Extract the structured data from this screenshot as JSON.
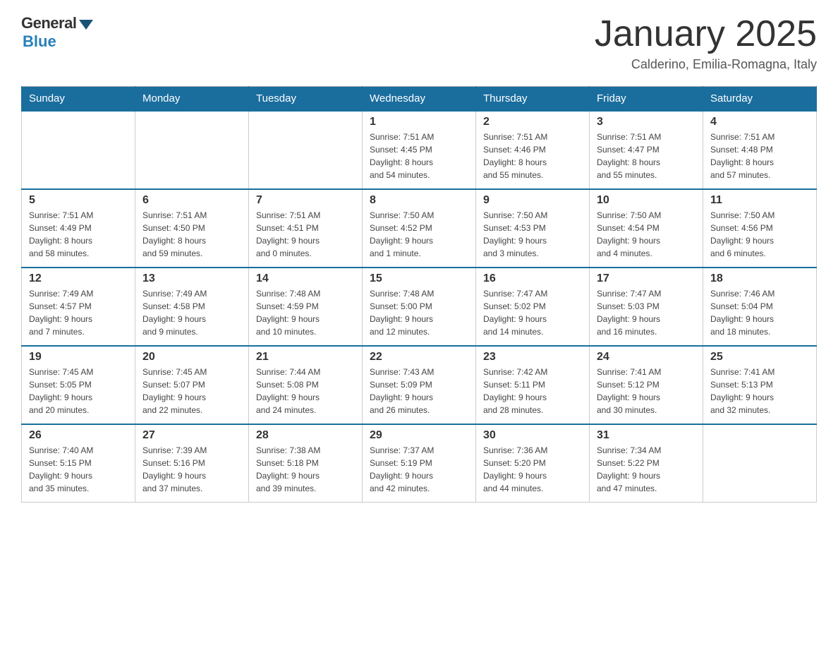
{
  "header": {
    "logo_general": "General",
    "logo_blue": "Blue",
    "month_title": "January 2025",
    "location": "Calderino, Emilia-Romagna, Italy"
  },
  "days_of_week": [
    "Sunday",
    "Monday",
    "Tuesday",
    "Wednesday",
    "Thursday",
    "Friday",
    "Saturday"
  ],
  "weeks": [
    [
      {
        "day": "",
        "info": ""
      },
      {
        "day": "",
        "info": ""
      },
      {
        "day": "",
        "info": ""
      },
      {
        "day": "1",
        "info": "Sunrise: 7:51 AM\nSunset: 4:45 PM\nDaylight: 8 hours\nand 54 minutes."
      },
      {
        "day": "2",
        "info": "Sunrise: 7:51 AM\nSunset: 4:46 PM\nDaylight: 8 hours\nand 55 minutes."
      },
      {
        "day": "3",
        "info": "Sunrise: 7:51 AM\nSunset: 4:47 PM\nDaylight: 8 hours\nand 55 minutes."
      },
      {
        "day": "4",
        "info": "Sunrise: 7:51 AM\nSunset: 4:48 PM\nDaylight: 8 hours\nand 57 minutes."
      }
    ],
    [
      {
        "day": "5",
        "info": "Sunrise: 7:51 AM\nSunset: 4:49 PM\nDaylight: 8 hours\nand 58 minutes."
      },
      {
        "day": "6",
        "info": "Sunrise: 7:51 AM\nSunset: 4:50 PM\nDaylight: 8 hours\nand 59 minutes."
      },
      {
        "day": "7",
        "info": "Sunrise: 7:51 AM\nSunset: 4:51 PM\nDaylight: 9 hours\nand 0 minutes."
      },
      {
        "day": "8",
        "info": "Sunrise: 7:50 AM\nSunset: 4:52 PM\nDaylight: 9 hours\nand 1 minute."
      },
      {
        "day": "9",
        "info": "Sunrise: 7:50 AM\nSunset: 4:53 PM\nDaylight: 9 hours\nand 3 minutes."
      },
      {
        "day": "10",
        "info": "Sunrise: 7:50 AM\nSunset: 4:54 PM\nDaylight: 9 hours\nand 4 minutes."
      },
      {
        "day": "11",
        "info": "Sunrise: 7:50 AM\nSunset: 4:56 PM\nDaylight: 9 hours\nand 6 minutes."
      }
    ],
    [
      {
        "day": "12",
        "info": "Sunrise: 7:49 AM\nSunset: 4:57 PM\nDaylight: 9 hours\nand 7 minutes."
      },
      {
        "day": "13",
        "info": "Sunrise: 7:49 AM\nSunset: 4:58 PM\nDaylight: 9 hours\nand 9 minutes."
      },
      {
        "day": "14",
        "info": "Sunrise: 7:48 AM\nSunset: 4:59 PM\nDaylight: 9 hours\nand 10 minutes."
      },
      {
        "day": "15",
        "info": "Sunrise: 7:48 AM\nSunset: 5:00 PM\nDaylight: 9 hours\nand 12 minutes."
      },
      {
        "day": "16",
        "info": "Sunrise: 7:47 AM\nSunset: 5:02 PM\nDaylight: 9 hours\nand 14 minutes."
      },
      {
        "day": "17",
        "info": "Sunrise: 7:47 AM\nSunset: 5:03 PM\nDaylight: 9 hours\nand 16 minutes."
      },
      {
        "day": "18",
        "info": "Sunrise: 7:46 AM\nSunset: 5:04 PM\nDaylight: 9 hours\nand 18 minutes."
      }
    ],
    [
      {
        "day": "19",
        "info": "Sunrise: 7:45 AM\nSunset: 5:05 PM\nDaylight: 9 hours\nand 20 minutes."
      },
      {
        "day": "20",
        "info": "Sunrise: 7:45 AM\nSunset: 5:07 PM\nDaylight: 9 hours\nand 22 minutes."
      },
      {
        "day": "21",
        "info": "Sunrise: 7:44 AM\nSunset: 5:08 PM\nDaylight: 9 hours\nand 24 minutes."
      },
      {
        "day": "22",
        "info": "Sunrise: 7:43 AM\nSunset: 5:09 PM\nDaylight: 9 hours\nand 26 minutes."
      },
      {
        "day": "23",
        "info": "Sunrise: 7:42 AM\nSunset: 5:11 PM\nDaylight: 9 hours\nand 28 minutes."
      },
      {
        "day": "24",
        "info": "Sunrise: 7:41 AM\nSunset: 5:12 PM\nDaylight: 9 hours\nand 30 minutes."
      },
      {
        "day": "25",
        "info": "Sunrise: 7:41 AM\nSunset: 5:13 PM\nDaylight: 9 hours\nand 32 minutes."
      }
    ],
    [
      {
        "day": "26",
        "info": "Sunrise: 7:40 AM\nSunset: 5:15 PM\nDaylight: 9 hours\nand 35 minutes."
      },
      {
        "day": "27",
        "info": "Sunrise: 7:39 AM\nSunset: 5:16 PM\nDaylight: 9 hours\nand 37 minutes."
      },
      {
        "day": "28",
        "info": "Sunrise: 7:38 AM\nSunset: 5:18 PM\nDaylight: 9 hours\nand 39 minutes."
      },
      {
        "day": "29",
        "info": "Sunrise: 7:37 AM\nSunset: 5:19 PM\nDaylight: 9 hours\nand 42 minutes."
      },
      {
        "day": "30",
        "info": "Sunrise: 7:36 AM\nSunset: 5:20 PM\nDaylight: 9 hours\nand 44 minutes."
      },
      {
        "day": "31",
        "info": "Sunrise: 7:34 AM\nSunset: 5:22 PM\nDaylight: 9 hours\nand 47 minutes."
      },
      {
        "day": "",
        "info": ""
      }
    ]
  ]
}
